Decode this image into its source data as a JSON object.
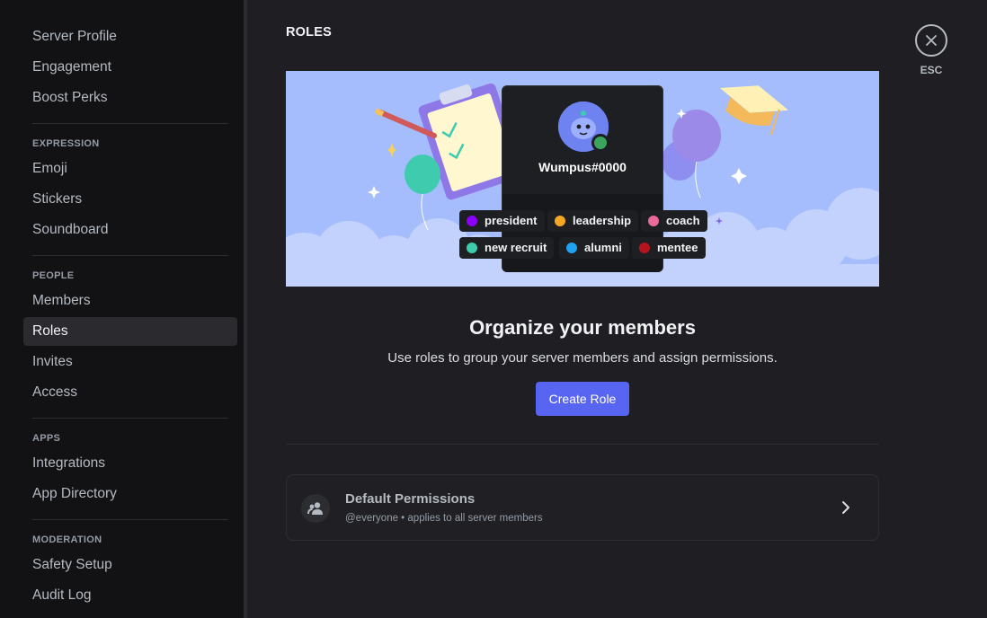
{
  "sidebar": {
    "top_items": [
      "Server Profile",
      "Engagement",
      "Boost Perks"
    ],
    "sections": [
      {
        "heading": "EXPRESSION",
        "items": [
          "Emoji",
          "Stickers",
          "Soundboard"
        ]
      },
      {
        "heading": "PEOPLE",
        "items": [
          "Members",
          "Roles",
          "Invites",
          "Access"
        ]
      },
      {
        "heading": "APPS",
        "items": [
          "Integrations",
          "App Directory"
        ]
      },
      {
        "heading": "MODERATION",
        "items": [
          "Safety Setup",
          "Audit Log"
        ]
      }
    ],
    "active_item": "Roles"
  },
  "main": {
    "title": "ROLES",
    "close": {
      "label": "ESC",
      "icon": "close-icon"
    },
    "banner": {
      "username": "Wumpus#0000",
      "roles": [
        {
          "name": "president",
          "color": "#8c00ff"
        },
        {
          "name": "leadership",
          "color": "#f5a623"
        },
        {
          "name": "coach",
          "color": "#eb6a9c"
        },
        {
          "name": "new recruit",
          "color": "#3ecbae"
        },
        {
          "name": "alumni",
          "color": "#1fa2f0"
        },
        {
          "name": "mentee",
          "color": "#b5141c"
        }
      ]
    },
    "heading": "Organize your members",
    "subheading": "Use roles to group your server members and assign permissions.",
    "create_button": "Create Role",
    "default_permissions": {
      "title": "Default Permissions",
      "subtitle": "@everyone • applies to all server members",
      "icon": "members-icon",
      "chevron_icon": "chevron-right-icon"
    }
  },
  "colors": {
    "accent": "#5865f2",
    "sidebar_bg": "#121214",
    "main_bg": "#1f1f23",
    "banner_bg": "#a5bdfc"
  }
}
